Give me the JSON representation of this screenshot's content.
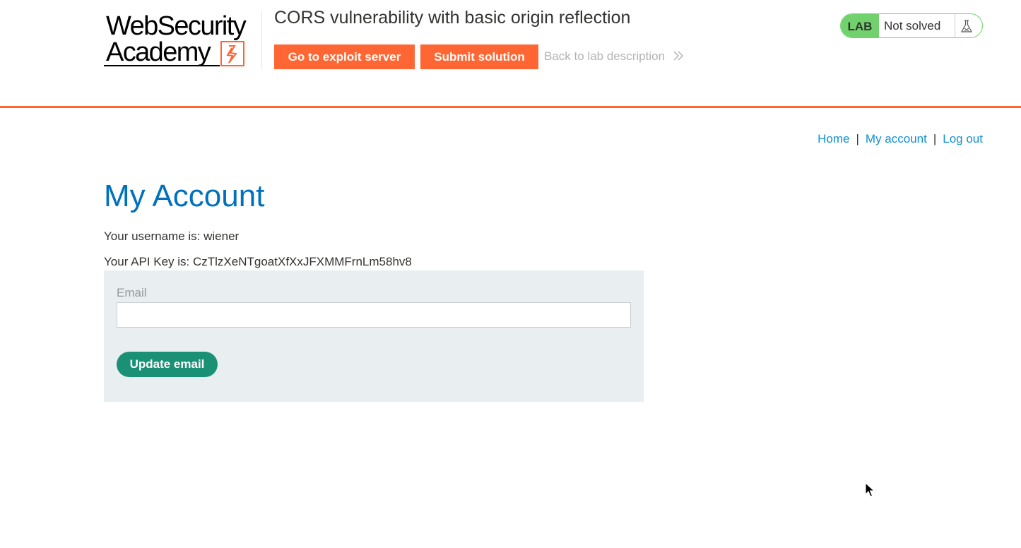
{
  "header": {
    "logo_line1": "WebSecurity",
    "logo_line2": "Academy",
    "lab_title": "CORS vulnerability with basic origin reflection",
    "exploit_button": "Go to exploit server",
    "submit_button": "Submit solution",
    "back_link": "Back to lab description",
    "lab_badge": "LAB",
    "lab_status": "Not solved"
  },
  "nav": {
    "home": "Home",
    "my_account": "My account",
    "log_out": "Log out",
    "separator": "|"
  },
  "main": {
    "title": "My Account",
    "username_line": "Your username is: wiener",
    "api_key_line": "Your API Key is: CzTlzXeNTgoatXfXxJFXMMFrnLm58hv8",
    "email_label": "Email",
    "email_value": "",
    "email_placeholder": "",
    "update_button": "Update email"
  },
  "colors": {
    "accent_orange": "#ff6633",
    "link_blue": "#0e90d2",
    "title_blue": "#0071bc",
    "lab_green": "#70d16d",
    "button_teal": "#1a9175",
    "panel_bg": "#e9eef0"
  },
  "icons": {
    "logo_mark": "lightning-bolt-icon",
    "back_chevron": "double-chevron-right-icon",
    "lab_flask": "flask-icon",
    "cursor": "mouse-pointer-icon"
  }
}
